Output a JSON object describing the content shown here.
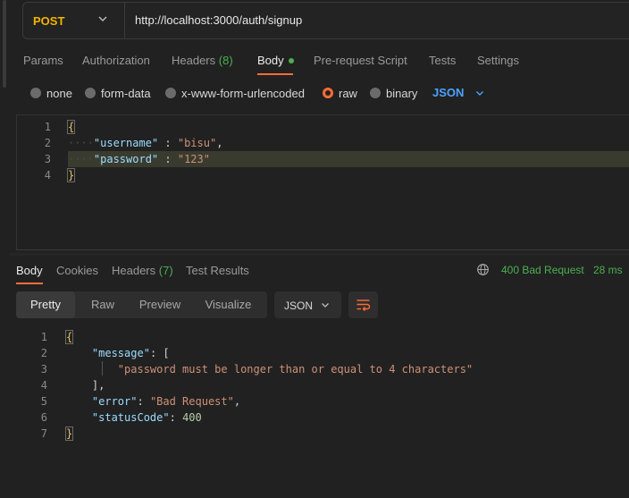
{
  "request": {
    "method": "POST",
    "url": "http://localhost:3000/auth/signup"
  },
  "request_tabs": {
    "params": "Params",
    "authorization": "Authorization",
    "headers": "Headers",
    "headers_count": "(8)",
    "body": "Body",
    "pre_request": "Pre-request Script",
    "tests": "Tests",
    "settings": "Settings"
  },
  "body_types": {
    "none": "none",
    "form_data": "form-data",
    "urlencoded": "x-www-form-urlencoded",
    "raw": "raw",
    "binary": "binary",
    "selected": "raw",
    "language": "JSON"
  },
  "request_editor": {
    "line_numbers": [
      "1",
      "2",
      "3",
      "4"
    ],
    "open_brace": "{",
    "username_key": "\"username\"",
    "username_value": "\"bisu\"",
    "password_key": "\"password\"",
    "password_value": "\"123\"",
    "close_brace": "}"
  },
  "response_tabs": {
    "body": "Body",
    "cookies": "Cookies",
    "headers": "Headers",
    "headers_count": "(7)",
    "test_results": "Test Results"
  },
  "response_status": {
    "status": "400 Bad Request",
    "time": "28 ms"
  },
  "response_toolbar": {
    "pretty": "Pretty",
    "raw": "Raw",
    "preview": "Preview",
    "visualize": "Visualize",
    "format": "JSON"
  },
  "response_editor": {
    "line_numbers": [
      "1",
      "2",
      "3",
      "4",
      "5",
      "6",
      "7"
    ],
    "open_brace": "{",
    "message_key": "\"message\"",
    "message_item": "\"password must be longer than or equal to 4 characters\"",
    "error_key": "\"error\"",
    "error_value": "\"Bad Request\"",
    "status_key": "\"statusCode\"",
    "status_value": "400",
    "close_brace": "}"
  },
  "colors": {
    "accent": "#ff6c37",
    "method": "#f4b400",
    "success": "#4caf50",
    "json_link": "#4da3ff"
  }
}
